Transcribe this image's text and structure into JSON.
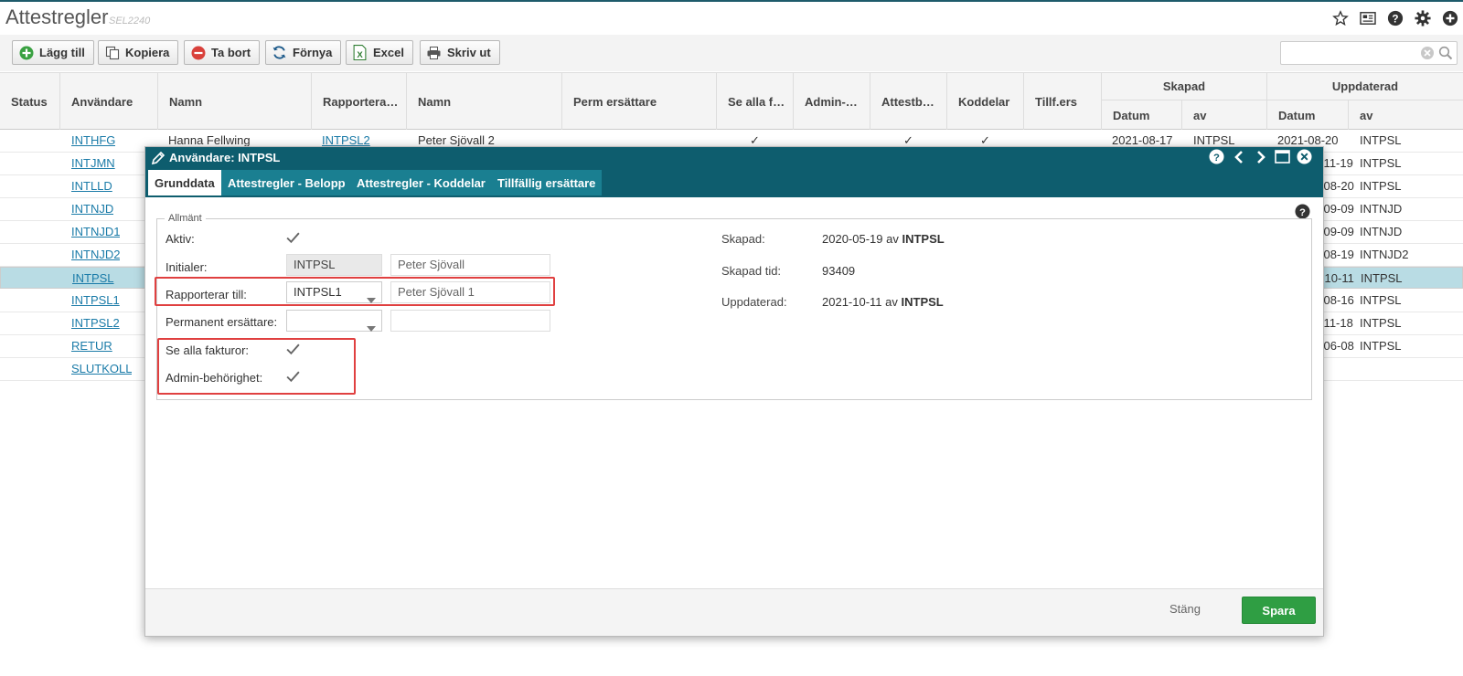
{
  "header": {
    "title": "Attestregler",
    "code": "SEL2240",
    "icons": [
      "star-icon",
      "news-icon",
      "help-icon",
      "settings-icon",
      "add-icon"
    ]
  },
  "toolbar": {
    "add_label": "Lägg till",
    "copy_label": "Kopiera",
    "delete_label": "Ta bort",
    "refresh_label": "Förnya",
    "excel_label": "Excel",
    "print_label": "Skriv ut",
    "search_value": ""
  },
  "grid": {
    "headers": {
      "status": "Status",
      "user": "Användare",
      "name": "Namn",
      "reports_to": "Rapportera…",
      "name2": "Namn",
      "perm": "Perm ersättare",
      "see_all": "Se alla f…",
      "admin": "Admin-…",
      "attest": "Attestb…",
      "code_parts": "Koddelar",
      "temp": "Tillf.ers",
      "created_group": "Skapad",
      "updated_group": "Uppdaterad",
      "created_date": "Datum",
      "created_by": "av",
      "updated_date": "Datum",
      "updated_by": "av"
    },
    "rows": [
      {
        "user": "INTHFG",
        "name": "Hanna Fellwing",
        "reports_to": "INTPSL2",
        "name2": "Peter Sjövall 2",
        "see_all": "✓",
        "attest": "✓",
        "code_parts": "✓",
        "created_date": "2021-08-17",
        "created_by": "INTPSL",
        "updated_date": "2021-08-20",
        "updated_by": "INTPSL"
      },
      {
        "user": "INTJMN",
        "updated_date": "1-11-19",
        "updated_by": "INTPSL"
      },
      {
        "user": "INTLLD",
        "updated_date": "1-08-20",
        "updated_by": "INTPSL"
      },
      {
        "user": "INTNJD",
        "updated_date": "1-09-09",
        "updated_by": "INTNJD"
      },
      {
        "user": "INTNJD1",
        "updated_date": "1-09-09",
        "updated_by": "INTNJD"
      },
      {
        "user": "INTNJD2",
        "updated_date": "1-08-19",
        "updated_by": "INTNJD2"
      },
      {
        "user": "INTPSL",
        "updated_date": "1-10-11",
        "updated_by": "INTPSL",
        "selected": true
      },
      {
        "user": "INTPSL1",
        "updated_date": "1-08-16",
        "updated_by": "INTPSL"
      },
      {
        "user": "INTPSL2",
        "updated_date": "1-11-18",
        "updated_by": "INTPSL"
      },
      {
        "user": "RETUR",
        "updated_date": "1-06-08",
        "updated_by": "INTPSL"
      },
      {
        "user": "SLUTKOLL"
      }
    ]
  },
  "modal": {
    "title": "Användare: INTPSL",
    "tabs": [
      "Grunddata",
      "Attestregler - Belopp",
      "Attestregler - Koddelar",
      "Tillfällig ersättare"
    ],
    "active_tab": 0,
    "fieldset_legend": "Allmänt",
    "fields": {
      "active_label": "Aktiv:",
      "active_checked": true,
      "initials_label": "Initialer:",
      "initials_value": "INTPSL",
      "initials_name": "Peter Sjövall",
      "reports_label": "Rapporterar till:",
      "reports_value": "INTPSL1",
      "reports_name": "Peter Sjövall 1",
      "perm_label": "Permanent ersättare:",
      "perm_value": "",
      "perm_name": "",
      "see_all_label": "Se alla fakturor:",
      "see_all_checked": true,
      "admin_label": "Admin-behörighet:",
      "admin_checked": true
    },
    "info": {
      "created_label": "Skapad:",
      "created_value": "2020-05-19 av",
      "created_by": "INTPSL",
      "created_time_label": "Skapad tid:",
      "created_time_value": "93409",
      "updated_label": "Uppdaterad:",
      "updated_value": "2021-10-11 av",
      "updated_by": "INTPSL"
    },
    "footer": {
      "close_label": "Stäng",
      "save_label": "Spara"
    },
    "colors": {
      "titlebar": "#0e5d6e",
      "tab": "#1a7f91",
      "save": "#2f9e43",
      "highlight": "#e04040"
    }
  }
}
